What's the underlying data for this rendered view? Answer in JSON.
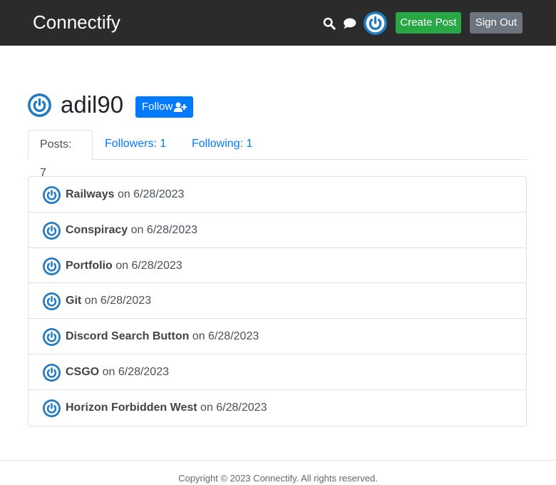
{
  "nav": {
    "brand": "Connectify",
    "create_post_label": "Create Post",
    "sign_out_label": "Sign Out"
  },
  "profile": {
    "username": "adil90",
    "follow_label": "Follow"
  },
  "tabs": [
    {
      "label": "Posts: 7"
    },
    {
      "label": "Followers: 1"
    },
    {
      "label": "Following: 1"
    }
  ],
  "posts": [
    {
      "title": "Railways",
      "date": "on 6/28/2023"
    },
    {
      "title": "Conspiracy",
      "date": "on 6/28/2023"
    },
    {
      "title": "Portfolio",
      "date": "on 6/28/2023"
    },
    {
      "title": "Git",
      "date": "on 6/28/2023"
    },
    {
      "title": "Discord Search Button",
      "date": "on 6/28/2023"
    },
    {
      "title": "CSGO",
      "date": "on 6/28/2023"
    },
    {
      "title": "Horizon Forbidden West",
      "date": "on 6/28/2023"
    }
  ],
  "footer": {
    "copyright": "Copyright © 2023 Connectify. All rights reserved."
  },
  "colors": {
    "navbar": "#2b2b2b",
    "create_button": "#28a745",
    "sign_out_button": "#6c757d",
    "follow_button": "#007bff",
    "avatar_blue": "#1e7bc4"
  },
  "icons": [
    "search-icon",
    "chat-icon",
    "power-avatar-icon",
    "user-plus-icon"
  ]
}
